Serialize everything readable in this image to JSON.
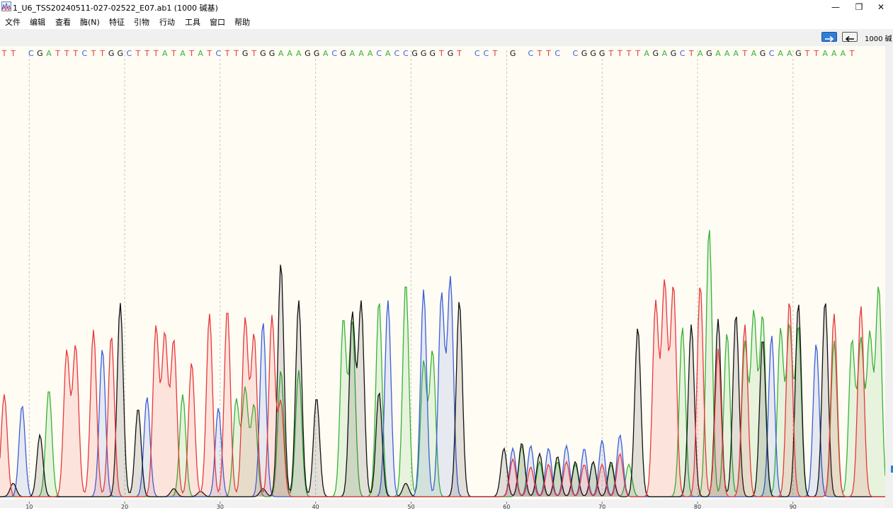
{
  "window": {
    "title": "1_U6_TSS20240511-027-02522_E07.ab1  (1000 碱基)",
    "controls": {
      "minimize": "—",
      "restore": "❐",
      "close": "✕"
    }
  },
  "menu": [
    "文件",
    "编辑",
    "查看",
    "酶(N)",
    "特征",
    "引物",
    "行动",
    "工具",
    "窗口",
    "帮助"
  ],
  "toolbar": {
    "count_label": "1000 碱"
  },
  "chart_data": {
    "type": "line",
    "title": "",
    "xlabel": "",
    "ylabel": "",
    "x_ticks": [
      10,
      20,
      30,
      40,
      50,
      60,
      70,
      80,
      90
    ],
    "base_calls": "TT CGATTTCTTGGCTTTATATATCTTGTGGAAAGGACGAAACACCGGGTGT CCT G CTTC CGGGTTTTAGAGCTAGAAATAGCAAGTTAAAT",
    "colors": {
      "A": "#36b336",
      "C": "#3a5fd9",
      "G": "#111111",
      "T": "#e8383a"
    },
    "series": [
      {
        "base": "A",
        "peaks": [
          [
            5,
            0.4
          ],
          [
            20,
            0.38
          ],
          [
            26,
            0.36
          ],
          [
            27,
            0.4
          ],
          [
            28,
            0.34
          ],
          [
            31,
            0.47
          ],
          [
            33,
            0.47
          ],
          [
            38,
            0.66
          ],
          [
            39,
            0.65
          ],
          [
            42,
            0.73
          ],
          [
            45,
            0.8
          ],
          [
            47,
            0.5
          ],
          [
            48,
            0.54
          ],
          [
            58,
            0.19
          ],
          [
            60,
            0.13
          ],
          [
            62,
            0.13
          ],
          [
            64,
            0.12
          ],
          [
            66,
            0.13
          ],
          [
            68,
            0.12
          ],
          [
            70,
            0.12
          ],
          [
            76,
            0.63
          ],
          [
            79,
            1.0
          ],
          [
            81,
            0.61
          ],
          [
            83,
            0.57
          ],
          [
            84,
            0.68
          ],
          [
            85,
            0.67
          ],
          [
            87,
            0.62
          ],
          [
            88,
            0.63
          ],
          [
            89,
            0.63
          ],
          [
            93,
            0.58
          ],
          [
            95,
            0.58
          ],
          [
            96,
            0.58
          ],
          [
            97,
            0.6
          ],
          [
            98,
            0.78
          ]
        ]
      },
      {
        "base": "C",
        "peaks": [
          [
            2,
            0.34
          ],
          [
            11,
            0.55
          ],
          [
            16,
            0.37
          ],
          [
            24,
            0.33
          ],
          [
            29,
            0.65
          ],
          [
            43,
            0.73
          ],
          [
            47,
            0.77
          ],
          [
            49,
            0.75
          ],
          [
            50,
            0.81
          ],
          [
            57,
            0.18
          ],
          [
            59,
            0.19
          ],
          [
            61,
            0.18
          ],
          [
            63,
            0.19
          ],
          [
            65,
            0.18
          ],
          [
            67,
            0.21
          ],
          [
            69,
            0.23
          ],
          [
            86,
            0.6
          ],
          [
            91,
            0.57
          ]
        ]
      },
      {
        "base": "G",
        "peaks": [
          [
            1,
            0.05
          ],
          [
            4,
            0.23
          ],
          [
            13,
            0.72
          ],
          [
            15,
            0.33
          ],
          [
            19,
            0.03
          ],
          [
            22,
            0.02
          ],
          [
            29,
            0.03
          ],
          [
            31,
            0.87
          ],
          [
            33,
            0.73
          ],
          [
            35,
            0.37
          ],
          [
            39,
            0.68
          ],
          [
            40,
            0.72
          ],
          [
            42,
            0.39
          ],
          [
            45,
            0.05
          ],
          [
            51,
            0.73
          ],
          [
            56,
            0.18
          ],
          [
            58,
            0.2
          ],
          [
            60,
            0.16
          ],
          [
            62,
            0.15
          ],
          [
            64,
            0.13
          ],
          [
            66,
            0.13
          ],
          [
            68,
            0.13
          ],
          [
            71,
            0.63
          ],
          [
            77,
            0.64
          ],
          [
            80,
            0.66
          ],
          [
            82,
            0.68
          ],
          [
            85,
            0.59
          ],
          [
            89,
            0.72
          ],
          [
            92,
            0.73
          ]
        ]
      },
      {
        "base": "T",
        "peaks": [
          [
            0,
            0.38
          ],
          [
            7,
            0.54
          ],
          [
            8,
            0.56
          ],
          [
            10,
            0.62
          ],
          [
            12,
            0.6
          ],
          [
            17,
            0.63
          ],
          [
            18,
            0.6
          ],
          [
            19,
            0.58
          ],
          [
            21,
            0.5
          ],
          [
            23,
            0.68
          ],
          [
            25,
            0.7
          ],
          [
            27,
            0.66
          ],
          [
            28,
            0.6
          ],
          [
            30,
            0.67
          ],
          [
            31,
            0.35
          ],
          [
            57,
            0.14
          ],
          [
            59,
            0.11
          ],
          [
            61,
            0.12
          ],
          [
            63,
            0.13
          ],
          [
            65,
            0.12
          ],
          [
            67,
            0.12
          ],
          [
            69,
            0.16
          ],
          [
            73,
            0.72
          ],
          [
            74,
            0.79
          ],
          [
            75,
            0.78
          ],
          [
            78,
            0.79
          ],
          [
            80,
            0.55
          ],
          [
            83,
            0.64
          ],
          [
            88,
            0.73
          ],
          [
            93,
            0.68
          ],
          [
            96,
            0.71
          ]
        ]
      }
    ]
  }
}
